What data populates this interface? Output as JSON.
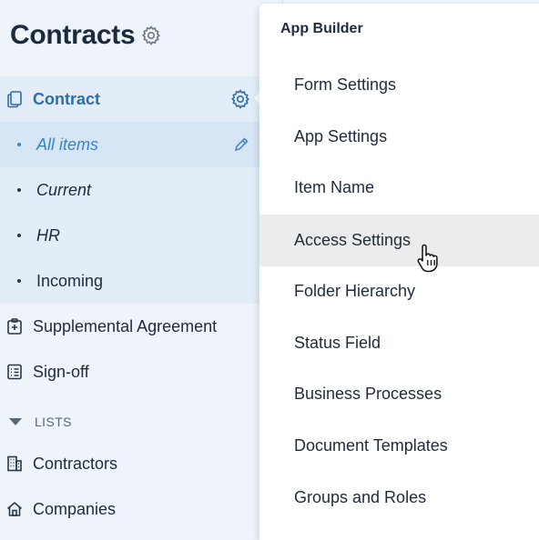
{
  "header": {
    "title": "Contracts"
  },
  "sidebar": {
    "contract": {
      "label": "Contract"
    },
    "subitems": [
      {
        "label": "All items"
      },
      {
        "label": "Current"
      },
      {
        "label": "HR"
      },
      {
        "label": "Incoming"
      }
    ],
    "items": [
      {
        "label": "Supplemental Agreement"
      },
      {
        "label": "Sign-off"
      }
    ],
    "lists_heading": "LISTS",
    "lists": [
      {
        "label": "Contractors"
      },
      {
        "label": "Companies"
      }
    ]
  },
  "menu": {
    "header": "App Builder",
    "items": [
      {
        "label": "Form Settings"
      },
      {
        "label": "App Settings"
      },
      {
        "label": "Item Name"
      },
      {
        "label": "Access Settings"
      },
      {
        "label": "Folder Hierarchy"
      },
      {
        "label": "Status Field"
      },
      {
        "label": "Business Processes"
      },
      {
        "label": "Document Templates"
      },
      {
        "label": "Groups and Roles"
      }
    ],
    "hovered_item": "Access Settings"
  },
  "colors": {
    "accent": "#3b82c4",
    "active_bg": "#d6e6f4",
    "sidebar_bg": "#eef4fa",
    "hover_bg": "#ececec"
  }
}
